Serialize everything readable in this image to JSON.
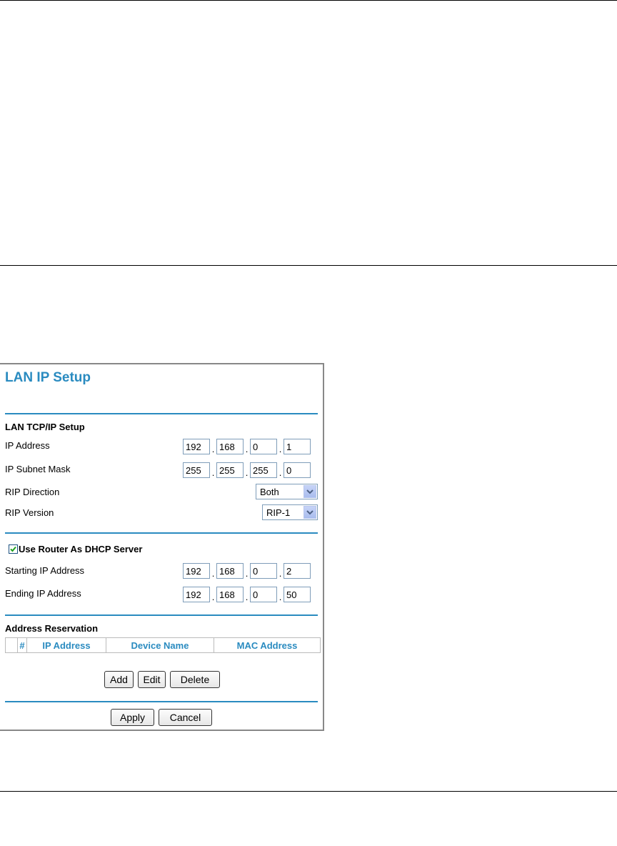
{
  "page": {
    "title": "LAN IP Setup",
    "lan": {
      "heading": "LAN TCP/IP Setup",
      "ip_label": "IP Address",
      "ip": [
        "192",
        "168",
        "0",
        "1"
      ],
      "mask_label": "IP Subnet Mask",
      "mask": [
        "255",
        "255",
        "255",
        "0"
      ],
      "rip_dir_label": "RIP Direction",
      "rip_dir": "Both",
      "rip_ver_label": "RIP Version",
      "rip_ver": "RIP-1"
    },
    "dhcp": {
      "checkbox_label": "Use Router As DHCP Server",
      "checked": true,
      "start_label": "Starting IP Address",
      "start": [
        "192",
        "168",
        "0",
        "2"
      ],
      "end_label": "Ending IP Address",
      "end": [
        "192",
        "168",
        "0",
        "50"
      ]
    },
    "reservation": {
      "heading": "Address Reservation",
      "columns": [
        "#",
        "IP Address",
        "Device Name",
        "MAC Address"
      ]
    },
    "buttons": {
      "add": "Add",
      "edit": "Edit",
      "delete": "Delete",
      "apply": "Apply",
      "cancel": "Cancel"
    },
    "colors": {
      "accent": "#2a8bc0",
      "check": "#21a121"
    },
    "icons": {
      "dropdown": "chevron-down-icon",
      "check": "check-icon"
    }
  }
}
